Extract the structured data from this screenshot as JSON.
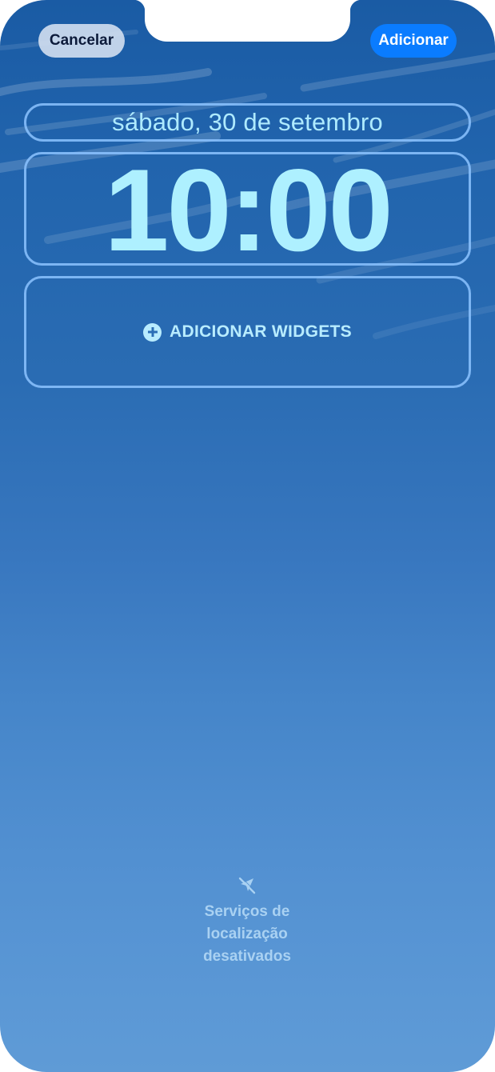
{
  "toolbar": {
    "cancel_label": "Cancelar",
    "add_label": "Adicionar"
  },
  "lock_screen": {
    "date": "sábado, 30 de setembro",
    "time": "10:00",
    "add_widgets_label": "ADICIONAR WIDGETS"
  },
  "location_status": {
    "icon": "location-off-icon",
    "text": "Serviços de localização desativados"
  },
  "colors": {
    "accent": "#0a7cff",
    "clock_tint": "#aef0ff",
    "frame_outline": "#8cc3ff",
    "wallpaper_top": "#1a5ba4",
    "wallpaper_bottom": "#5f9bd6"
  }
}
